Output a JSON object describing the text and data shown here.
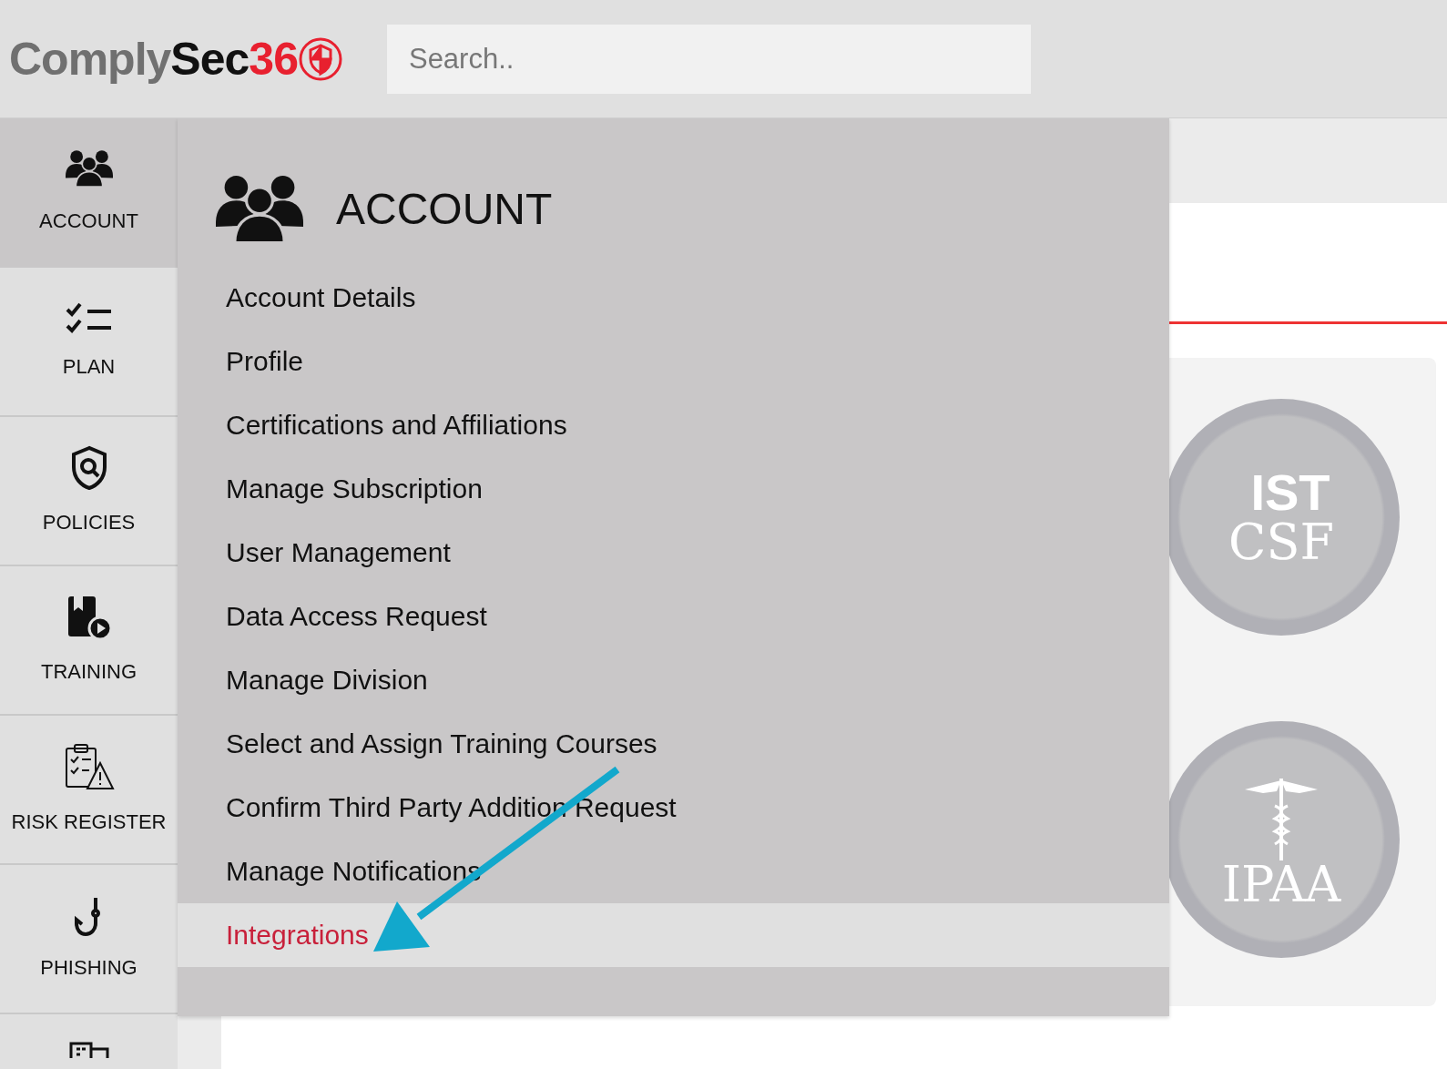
{
  "header": {
    "logo": [
      {
        "text": "Comply",
        "color": "#707070"
      },
      {
        "text": "Sec",
        "color": "#111111"
      },
      {
        "text": "36",
        "color": "#e8202f"
      }
    ],
    "search": {
      "placeholder": "Search.."
    }
  },
  "sidebar": {
    "items": [
      {
        "label": "ACCOUNT",
        "selected": true
      },
      {
        "label": "PLAN",
        "selected": false
      },
      {
        "label": "POLICIES",
        "selected": false
      },
      {
        "label": "TRAINING",
        "selected": false
      },
      {
        "label": "RISK REGISTER",
        "selected": false
      },
      {
        "label": "PHISHING",
        "selected": false
      },
      {
        "selected": false
      }
    ]
  },
  "menu": {
    "title": "ACCOUNT",
    "items": [
      {
        "label": "Account Details",
        "selected": false
      },
      {
        "label": "Profile",
        "selected": false
      },
      {
        "label": "Certifications and Affiliations",
        "selected": false
      },
      {
        "label": "Manage Subscription",
        "selected": false
      },
      {
        "label": "User Management",
        "selected": false
      },
      {
        "label": "Data Access Request",
        "selected": false
      },
      {
        "label": "Manage Division",
        "selected": false
      },
      {
        "label": "Select and Assign Training Courses",
        "selected": false
      },
      {
        "label": "Confirm Third Party Addition Request",
        "selected": false
      },
      {
        "label": "Manage Notifications",
        "selected": false
      },
      {
        "label": "Integrations",
        "selected": true
      }
    ]
  },
  "badges": [
    {
      "kind": "nist",
      "logo": "IST",
      "text": "CSF"
    },
    {
      "kind": "hipaa",
      "text": "IPAA"
    }
  ]
}
